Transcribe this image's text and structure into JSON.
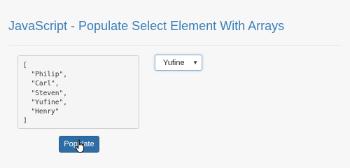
{
  "page": {
    "title": "JavaScript - Populate Select Element With Arrays"
  },
  "code_panel": {
    "lines": [
      "[",
      "  \"Philip\",",
      "  \"Carl\",",
      "  \"Steven\",",
      "  \"Yufine\",",
      "  \"Henry\"",
      "]"
    ]
  },
  "select": {
    "value": "Yufine"
  },
  "populate_button": {
    "label": "Populate"
  },
  "colors": {
    "title": "#3a7fb8",
    "button": "#2e6da4"
  },
  "icons": {
    "select_arrow": "caret-down-icon",
    "cursor": "hand-pointer-icon"
  }
}
